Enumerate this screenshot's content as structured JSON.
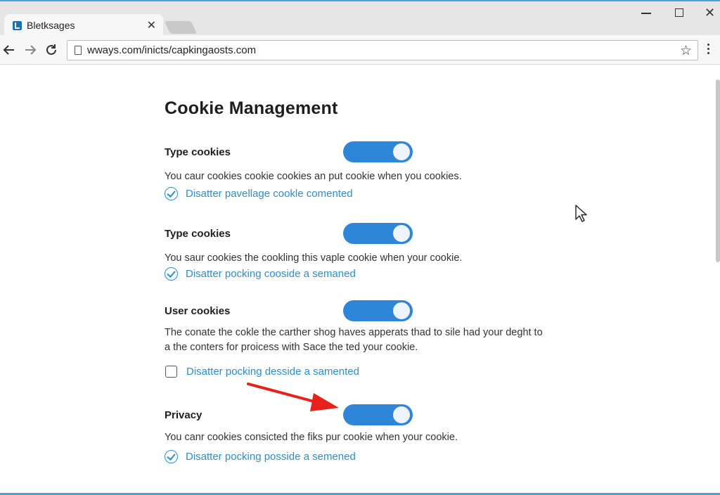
{
  "browser": {
    "tab_title": "Bletksages",
    "tab_close": "✕",
    "url": "wways.com/inicts/capkingaosts.com",
    "star": "☆",
    "close_window": "✕"
  },
  "page": {
    "title": "Cookie Management",
    "sections": [
      {
        "title": "Type cookies",
        "toggle_on": true,
        "description": "You caur cookies cookie cookies an put cookie when you cookies.",
        "option": {
          "label": "Disatter pavellage cookle comented",
          "checked": true
        }
      },
      {
        "title": "Type cookies",
        "toggle_on": true,
        "description": "You saur cookies the cookling this vaple cookie when your cookie.",
        "option": {
          "label": "Disatter pocking cooside a semaned",
          "checked": true
        }
      },
      {
        "title": "User cookies",
        "toggle_on": true,
        "description": "The conate the cokle the carther shog haves apperats thad to sile had your deght to a the conters for proicess with Sace the ted your cookie.",
        "option": {
          "label": "Disatter pocking desside a samented",
          "checked": false
        }
      },
      {
        "title": "Privacy",
        "toggle_on": true,
        "description": "You canr cookies consicted the fiks pur cookie when your cookie.",
        "option": {
          "label": "Disatter pocking posside a semened",
          "checked": true
        }
      }
    ]
  },
  "colors": {
    "toggle": "#2f86d9",
    "link": "#2a8fd0",
    "arrow": "#e8211b"
  },
  "icons": [
    "favicon-icon",
    "back-icon",
    "forward-icon",
    "reload-icon",
    "page-icon",
    "star-icon",
    "menu-icon",
    "check-icon",
    "cursor-icon",
    "arrow-icon"
  ]
}
